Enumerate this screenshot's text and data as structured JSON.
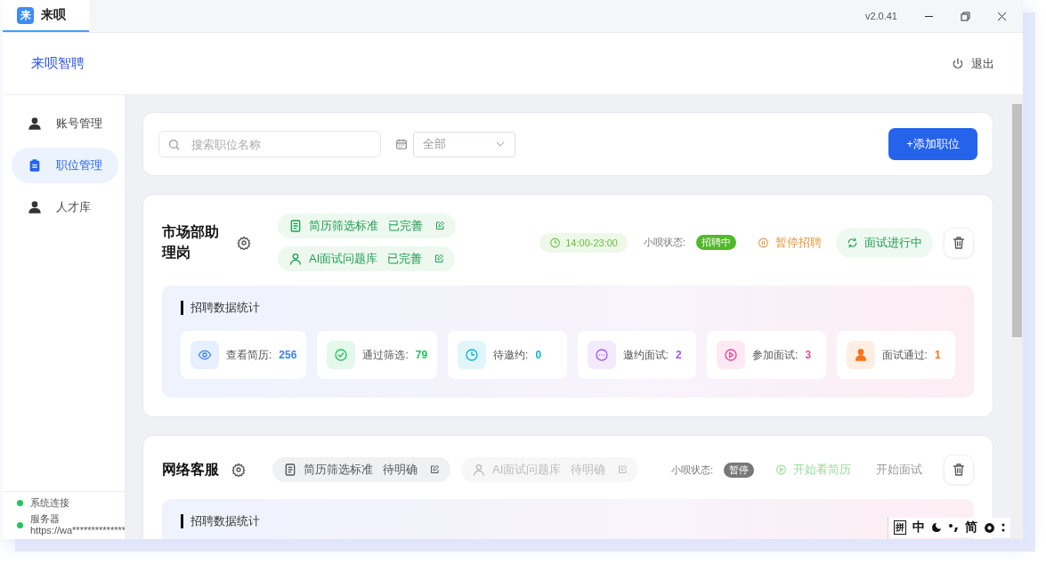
{
  "window": {
    "tab": {
      "logo": "来",
      "title": "来呗",
      "selected": true
    },
    "version": "v2.0.41"
  },
  "header": {
    "brand": "来呗智聘",
    "logout": "退出"
  },
  "sidebar": {
    "items": [
      {
        "label": "账号管理",
        "selected": false
      },
      {
        "label": "职位管理",
        "selected": true
      },
      {
        "label": "人才库",
        "selected": false
      }
    ],
    "status": [
      {
        "label": "系统连接",
        "color": "#22c55e"
      },
      {
        "label": "服务器",
        "detail": "https://wa**************",
        "color": "#22c55e"
      }
    ]
  },
  "toolbar": {
    "search": {
      "placeholder": "搜索职位名称"
    },
    "filter": {
      "value": "全部"
    },
    "add_button": "+添加职位"
  },
  "jobs": [
    {
      "title": "市场部助理岗",
      "tags": [
        {
          "label": "简历筛选标准",
          "status": "已完善",
          "completed": true,
          "disabled": false
        },
        {
          "label": "AI面试问题库",
          "status": "已完善",
          "completed": true,
          "disabled": false
        }
      ],
      "time": "14:00-23:00",
      "bot_label": "小呗状态:",
      "bot_status": {
        "label": "招聘中",
        "kind": "recruiting"
      },
      "actions": [
        {
          "kind": "pause",
          "label": "暂停招聘",
          "disabled": false
        },
        {
          "kind": "interviewing",
          "label": "面试进行中",
          "disabled": false
        }
      ],
      "stats_title": "招聘数据统计",
      "stats": [
        {
          "label": "查看简历:",
          "value": "256",
          "color": "#3b82f6"
        },
        {
          "label": "通过筛选:",
          "value": "79",
          "color": "#22c55e"
        },
        {
          "label": "待邀约:",
          "value": "0",
          "color": "#06b6d4"
        },
        {
          "label": "邀约面试:",
          "value": "2",
          "color": "#a855f7"
        },
        {
          "label": "参加面试:",
          "value": "3",
          "color": "#ec4899"
        },
        {
          "label": "面试通过:",
          "value": "1",
          "color": "#f97316"
        }
      ]
    },
    {
      "title": "网络客服",
      "tags": [
        {
          "label": "简历筛选标准",
          "status": "待明确",
          "completed": false,
          "disabled": false
        },
        {
          "label": "AI面试问题库",
          "status": "待明确",
          "completed": false,
          "disabled": true
        }
      ],
      "bot_label": "小呗状态:",
      "bot_status": {
        "label": "暂停",
        "kind": "paused"
      },
      "actions": [
        {
          "kind": "start-review",
          "label": "开始看简历",
          "disabled": true
        },
        {
          "kind": "start-interview",
          "label": "开始面试",
          "disabled": true
        }
      ],
      "stats_title": "招聘数据统计"
    }
  ],
  "ime": {
    "mode": "拼",
    "language": "中",
    "charset": "简"
  }
}
